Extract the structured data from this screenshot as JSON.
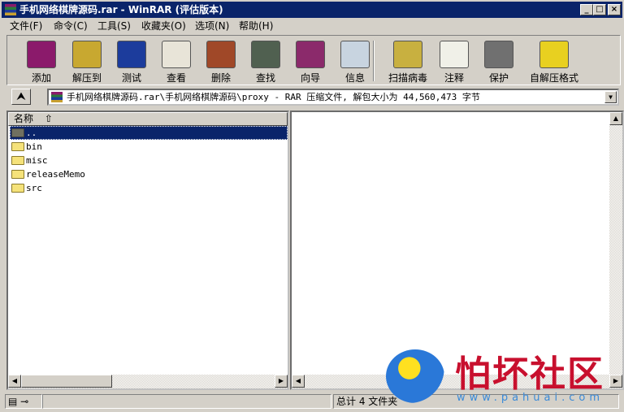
{
  "window": {
    "title": "手机网络棋牌源码.rar - WinRAR (评估版本)",
    "min": "_",
    "max": "□",
    "close": "×"
  },
  "menu": [
    "文件(F)",
    "命令(C)",
    "工具(S)",
    "收藏夹(O)",
    "选项(N)",
    "帮助(H)"
  ],
  "toolbar": [
    {
      "label": "添加",
      "icon": "add-archive-icon",
      "color": "#8b1a6b"
    },
    {
      "label": "解压到",
      "icon": "extract-to-icon",
      "color": "#c8a830"
    },
    {
      "label": "测试",
      "icon": "test-icon",
      "color": "#1c3c9c"
    },
    {
      "label": "查看",
      "icon": "view-icon",
      "color": "#e8e4d8"
    },
    {
      "label": "删除",
      "icon": "delete-icon",
      "color": "#a04828"
    },
    {
      "label": "查找",
      "icon": "find-icon",
      "color": "#506050"
    },
    {
      "label": "向导",
      "icon": "wizard-icon",
      "color": "#8b2a6b"
    },
    {
      "label": "信息",
      "icon": "info-icon",
      "color": "#c8d4e0"
    },
    {
      "label": "扫描病毒",
      "icon": "virus-scan-icon",
      "color": "#c8b040"
    },
    {
      "label": "注释",
      "icon": "comment-icon",
      "color": "#f0f0e8"
    },
    {
      "label": "保护",
      "icon": "protect-icon",
      "color": "#707070"
    },
    {
      "label": "自解压格式",
      "icon": "sfx-icon",
      "color": "#e8d020"
    }
  ],
  "address": {
    "path": "手机网络棋牌源码.rar\\手机网络棋牌源码\\proxy - RAR 压缩文件, 解包大小为 44,560,473 字节",
    "up": "⮝"
  },
  "list": {
    "header": "名称",
    "sort_arrow": "⇧",
    "rows": [
      "..",
      "bin",
      "misc",
      "releaseMemo",
      "src"
    ]
  },
  "status": {
    "text": "总计 4 文件夹"
  },
  "watermark": {
    "text": "怕坏社区",
    "url": "www.pahuai.com"
  }
}
